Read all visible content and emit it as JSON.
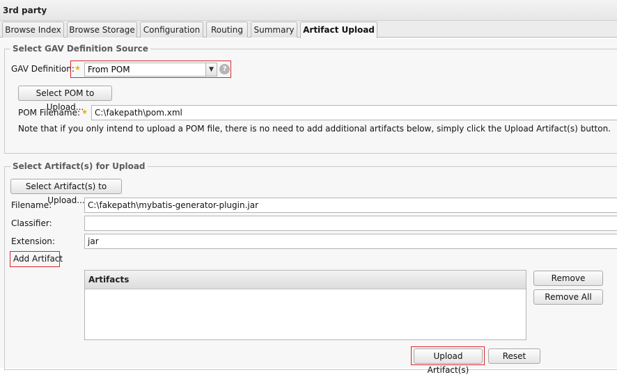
{
  "panel": {
    "title": "3rd party"
  },
  "tabs": [
    {
      "label": "Browse Index"
    },
    {
      "label": "Browse Storage"
    },
    {
      "label": "Configuration"
    },
    {
      "label": "Routing"
    },
    {
      "label": "Summary"
    },
    {
      "label": "Artifact Upload",
      "active": true
    }
  ],
  "gav_section": {
    "legend": "Select GAV Definition Source",
    "gav_label": "GAV Definition:",
    "gav_value": "From POM",
    "help_icon": "question-icon",
    "select_pom_button": "Select POM to Upload...",
    "pom_filename_label": "POM Filename:",
    "pom_filename_value": "C:\\fakepath\\pom.xml",
    "note": "Note that if you only intend to upload a POM file, there is no need to add additional artifacts below, simply click the Upload Artifact(s) button."
  },
  "artifact_section": {
    "legend": "Select Artifact(s) for Upload",
    "select_artifacts_button": "Select Artifact(s) to Upload...",
    "filename_label": "Filename:",
    "filename_value": "C:\\fakepath\\mybatis-generator-plugin.jar",
    "classifier_label": "Classifier:",
    "classifier_value": "",
    "extension_label": "Extension:",
    "extension_value": "jar",
    "add_artifact_button": "Add Artifact",
    "artifacts_header": "Artifacts",
    "remove_button": "Remove",
    "remove_all_button": "Remove All"
  },
  "footer": {
    "upload_button": "Upload Artifact(s)",
    "reset_button": "Reset"
  },
  "colors": {
    "highlight_red": "#d9252b",
    "required_star": "#e9b400",
    "legend_text": "#5b5b5b"
  }
}
